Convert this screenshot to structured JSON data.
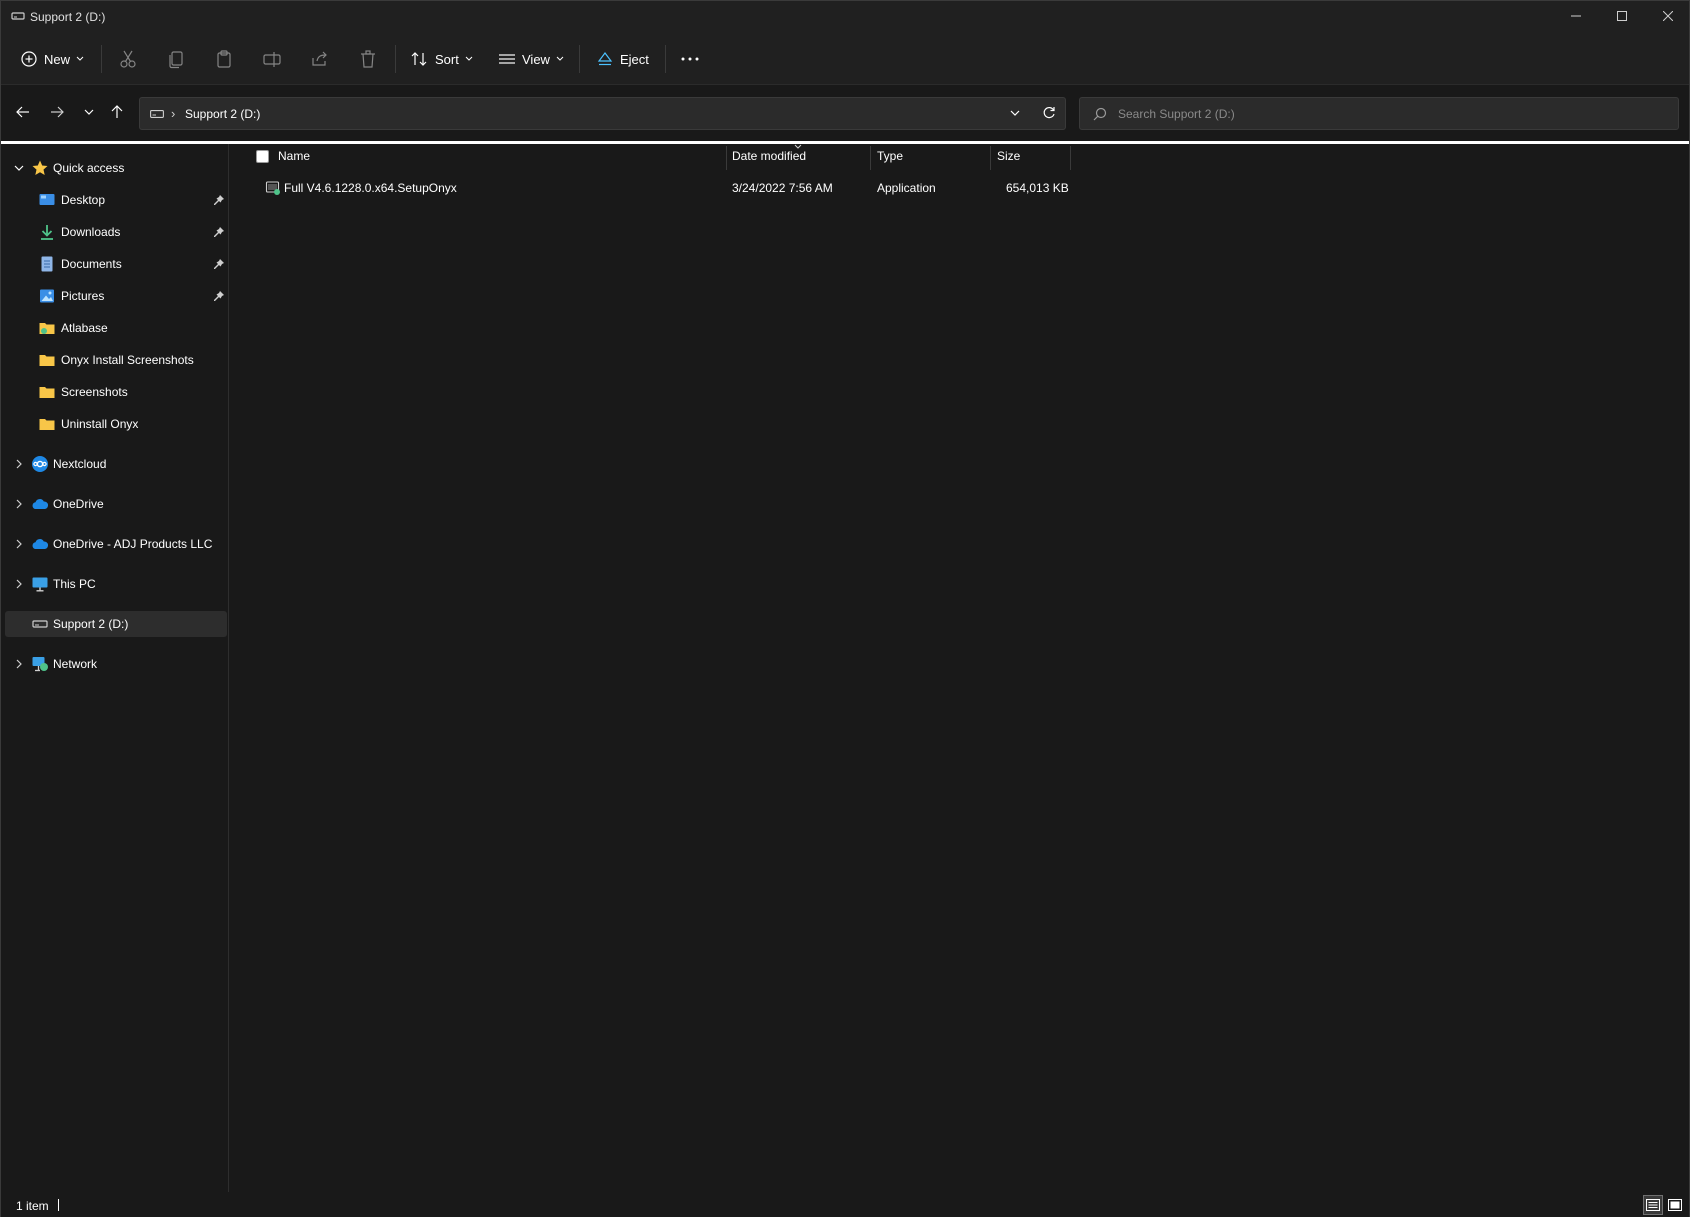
{
  "window": {
    "title": "Support 2 (D:)"
  },
  "toolbar": {
    "new_label": "New",
    "sort_label": "Sort",
    "view_label": "View",
    "eject_label": "Eject",
    "disabled_icons": [
      "cut-icon",
      "copy-icon",
      "paste-icon",
      "rename-icon",
      "share-icon",
      "delete-icon"
    ],
    "more_icon": "more-icon"
  },
  "address": {
    "crumb": "Support 2 (D:)",
    "separator": "›"
  },
  "search": {
    "placeholder": "Search Support 2 (D:)"
  },
  "sidebar": {
    "quick_access": "Quick access",
    "pinned": [
      {
        "label": "Desktop",
        "icon": "desktop-icon"
      },
      {
        "label": "Downloads",
        "icon": "downloads-icon"
      },
      {
        "label": "Documents",
        "icon": "documents-icon"
      },
      {
        "label": "Pictures",
        "icon": "pictures-icon"
      }
    ],
    "folders": [
      {
        "label": "Atlabase",
        "icon": "folder-icon"
      },
      {
        "label": "Onyx Install Screenshots",
        "icon": "folder-icon"
      },
      {
        "label": "Screenshots",
        "icon": "folder-icon"
      },
      {
        "label": "Uninstall Onyx",
        "icon": "folder-icon"
      }
    ],
    "roots": [
      {
        "label": "Nextcloud",
        "icon": "nextcloud-icon"
      },
      {
        "label": "OneDrive",
        "icon": "onedrive-icon"
      },
      {
        "label": "OneDrive - ADJ Products LLC",
        "icon": "onedrive-icon"
      },
      {
        "label": "This PC",
        "icon": "this-pc-icon"
      },
      {
        "label": "Support 2 (D:)",
        "icon": "drive-icon"
      },
      {
        "label": "Network",
        "icon": "network-icon"
      }
    ],
    "selected": "Support 2 (D:)"
  },
  "columns": {
    "name": "Name",
    "date_modified": "Date modified",
    "type": "Type",
    "size": "Size"
  },
  "files": [
    {
      "name": "Full V4.6.1228.0.x64.SetupOnyx",
      "date_modified": "3/24/2022 7:56 AM",
      "type": "Application",
      "size": "654,013 KB",
      "icon": "application-icon"
    }
  ],
  "status": {
    "item_count": "1 item"
  },
  "colors": {
    "background": "#191919",
    "chrome": "#202020",
    "accent": "#4cc2ff",
    "folder": "#f8c648"
  }
}
